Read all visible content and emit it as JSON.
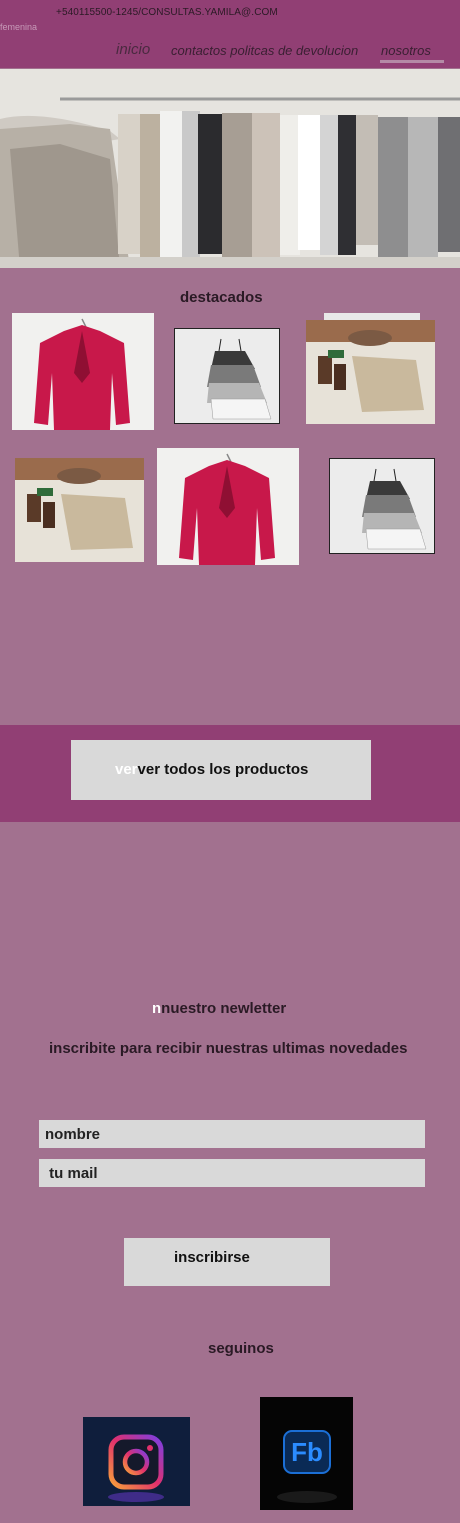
{
  "header": {
    "contact": "+540115500-1245/CONSULTAS.YAMILA@.COM",
    "brand_fragment": "femenina",
    "nav": {
      "inicio": "inicio",
      "contactos": "contactos politcas de devolucion",
      "nosotros": "nosotros"
    }
  },
  "featured": {
    "title": "destacados",
    "products": [
      {
        "image": "red-blazer"
      },
      {
        "image": "camisole-set"
      },
      {
        "image": "outfit-flatlay"
      },
      {
        "image": "outfit-flatlay"
      },
      {
        "image": "red-blazer"
      },
      {
        "image": "camisole-set"
      }
    ]
  },
  "cta": {
    "ghost_prefix": "ver",
    "label": "ver  todos los productos"
  },
  "newsletter": {
    "ghost_prefix": "n",
    "title": "nuestro newletter",
    "subtitle": "inscribite para recibir nuestras ultimas novedades",
    "name_placeholder": "nombre",
    "mail_placeholder": " tu mail",
    "submit_label": "inscribirse"
  },
  "social": {
    "title": "seguinos",
    "instagram": "instagram-icon",
    "facebook_text": "Fb"
  },
  "colors": {
    "background": "#a2718f",
    "header": "#913f74",
    "button": "#d9d9d9",
    "blazer": "#c8184a"
  }
}
